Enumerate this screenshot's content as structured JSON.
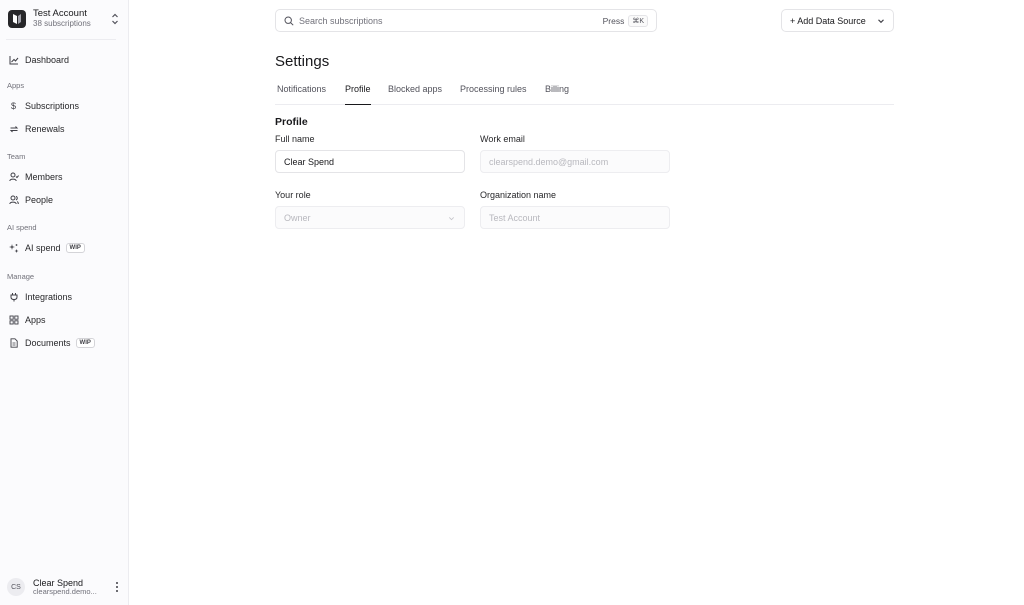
{
  "account": {
    "name": "Test Account",
    "subtitle": "38 subscriptions"
  },
  "sidebar": {
    "dashboard": "Dashboard",
    "sections": {
      "apps": "Apps",
      "team": "Team",
      "ai_spend": "AI spend",
      "manage": "Manage"
    },
    "items": {
      "subscriptions": "Subscriptions",
      "renewals": "Renewals",
      "members": "Members",
      "people": "People",
      "ai_spend": "AI spend",
      "integrations": "Integrations",
      "apps": "Apps",
      "documents": "Documents"
    },
    "wip_badge": "WIP"
  },
  "user": {
    "initials": "CS",
    "name": "Clear Spend",
    "email": "clearspend.demo..."
  },
  "search": {
    "placeholder": "Search subscriptions",
    "press": "Press",
    "shortcut": "⌘K"
  },
  "toolbar": {
    "add_data_source": "+ Add Data Source"
  },
  "page": {
    "title": "Settings",
    "tabs": [
      "Notifications",
      "Profile",
      "Blocked apps",
      "Processing rules",
      "Billing"
    ],
    "active_tab": "Profile"
  },
  "profile": {
    "section_title": "Profile",
    "full_name": {
      "label": "Full name",
      "value": "Clear Spend"
    },
    "work_email": {
      "label": "Work email",
      "value": "clearspend.demo@gmail.com"
    },
    "role": {
      "label": "Your role",
      "value": "Owner"
    },
    "organization": {
      "label": "Organization name",
      "value": "Test Account"
    }
  },
  "colors": {
    "accent": "#18181b",
    "sidebar_bg": "#fbfbfd",
    "border": "#e4e4e7"
  },
  "icons": [
    "chart-line-icon",
    "dollar-icon",
    "refresh-icon",
    "user-icon",
    "people-icon",
    "sparkles-icon",
    "plug-icon",
    "grid-icon",
    "document-icon",
    "search-icon",
    "chevron-down-icon",
    "chevron-updown-icon",
    "kebab-icon"
  ]
}
